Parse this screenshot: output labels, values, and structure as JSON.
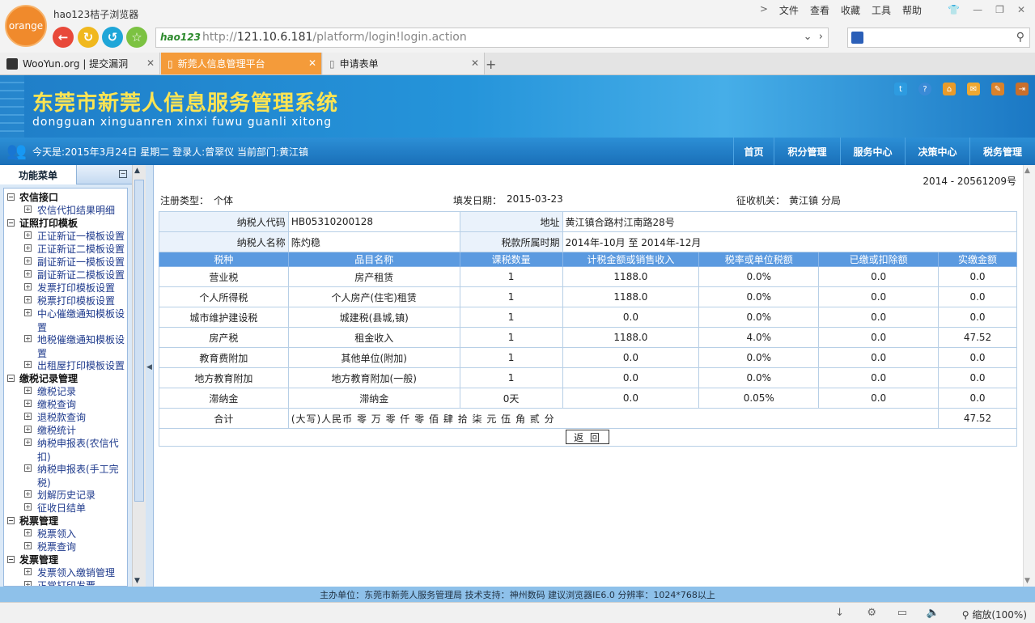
{
  "browser": {
    "logo": "orange",
    "name": "hao123桔子浏览器",
    "menu": [
      "文件",
      "查看",
      "收藏",
      "工具",
      "帮助"
    ],
    "url_brand": "hao123",
    "url_host": "121.10.6.181",
    "url_prefix": "http://",
    "url_path": "/platform/login!login.action",
    "tabs": [
      {
        "label": "WooYun.org | 提交漏洞"
      },
      {
        "label": "新莞人信息管理平台"
      },
      {
        "label": "申请表单"
      }
    ],
    "zoom": "缩放(100%)"
  },
  "header": {
    "title": "东莞市新莞人信息服务管理系统",
    "pinyin": "dongguan xinguanren xinxi fuwu guanli xitong",
    "user_info": "今天是:2015年3月24日  星期二  登录人:曾翠仪  当前部门:黄江镇",
    "nav": [
      "首页",
      "积分管理",
      "服务中心",
      "决策中心",
      "税务管理"
    ]
  },
  "sidebar": {
    "title": "功能菜单",
    "groups": [
      {
        "label": "农信接口",
        "items": [
          "农信代扣结果明细"
        ]
      },
      {
        "label": "证照打印模板",
        "items": [
          "正证新证一模板设置",
          "正证新证二模板设置",
          "副证新证一模板设置",
          "副证新证二模板设置",
          "发票打印模板设置",
          "税票打印模板设置",
          "中心催缴通知模板设置",
          "地税催缴通知模板设置",
          "出租屋打印模板设置"
        ]
      },
      {
        "label": "缴税记录管理",
        "items": [
          "缴税记录",
          "缴税查询",
          "退税款查询",
          "缴税统计",
          "纳税申报表(农信代扣)",
          "纳税申报表(手工完税)",
          "划解历史记录",
          "征收日结单"
        ]
      },
      {
        "label": "税票管理",
        "items": [
          "税票领入",
          "税票查询"
        ]
      },
      {
        "label": "发票管理",
        "items": [
          "发票领入缴销管理",
          "正常打印发票"
        ]
      }
    ]
  },
  "form": {
    "doc_no": "2014 - 20561209号",
    "reg_type_label": "注册类型：",
    "reg_type": "个体",
    "fill_date_label": "填发日期：",
    "fill_date": "2015-03-23",
    "authority_label": "征收机关：",
    "authority": "黄江镇 分局",
    "taxpayer_code_label": "纳税人代码",
    "taxpayer_code": "HB05310200128",
    "address_label": "地址",
    "address": "黄江镇合路村江南路28号",
    "taxpayer_name_label": "纳税人名称",
    "taxpayer_name": "陈灼稳",
    "period_label": "税款所属时期",
    "period": "2014年-10月  至  2014年-12月",
    "columns": [
      "税种",
      "品目名称",
      "课税数量",
      "计税金额或销售收入",
      "税率或单位税额",
      "已缴或扣除额",
      "实缴金额"
    ],
    "rows": [
      [
        "营业税",
        "房产租赁",
        "1",
        "1188.0",
        "0.0%",
        "0.0",
        "0.0"
      ],
      [
        "个人所得税",
        "个人房产(住宅)租赁",
        "1",
        "1188.0",
        "0.0%",
        "0.0",
        "0.0"
      ],
      [
        "城市维护建设税",
        "城建税(县城,镇)",
        "1",
        "0.0",
        "0.0%",
        "0.0",
        "0.0"
      ],
      [
        "房产税",
        "租金收入",
        "1",
        "1188.0",
        "4.0%",
        "0.0",
        "47.52"
      ],
      [
        "教育费附加",
        "其他单位(附加)",
        "1",
        "0.0",
        "0.0%",
        "0.0",
        "0.0"
      ],
      [
        "地方教育附加",
        "地方教育附加(一般)",
        "1",
        "0.0",
        "0.0%",
        "0.0",
        "0.0"
      ],
      [
        "滞纳金",
        "滞纳金",
        "0天",
        "0.0",
        "0.05%",
        "0.0",
        "0.0"
      ]
    ],
    "total_label": "合计",
    "total_words": "(大写)人民币 零 万 零 仟 零 佰 肆 拾 柒 元 伍 角 贰 分",
    "total_amount": "47.52",
    "back_label": "返 回"
  },
  "footer": {
    "text": "主办单位：东莞市新莞人服务管理局    技术支持：神州数码    建议浏览器IE6.0 分辨率：1024*768以上"
  }
}
